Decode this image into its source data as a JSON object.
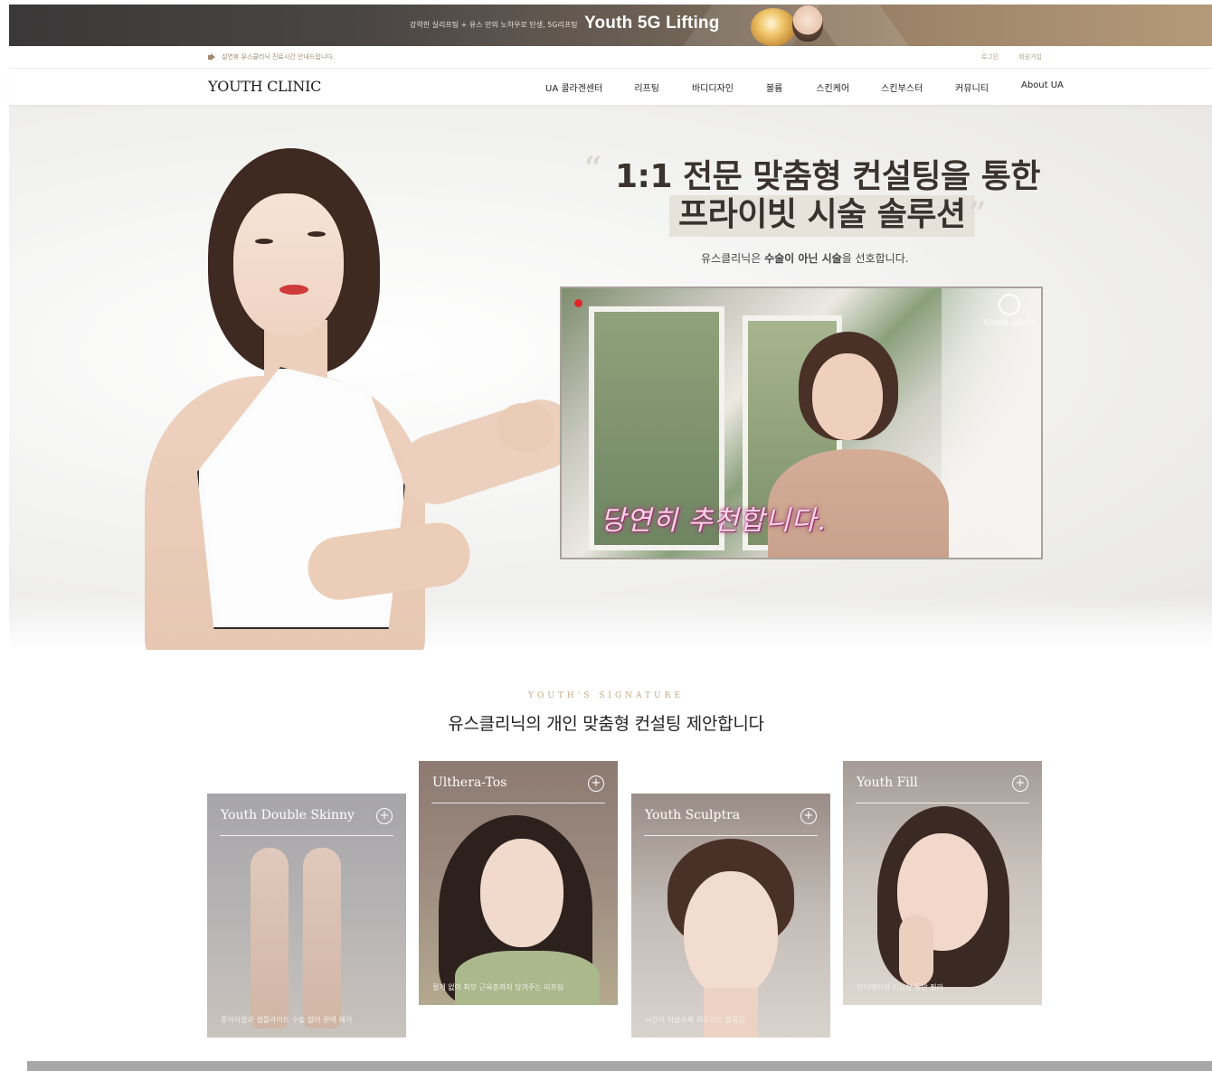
{
  "promo": {
    "small_text": "강력한 실리프팅 + 유스 만의 노하우로 탄생, 5G리프팅",
    "big_text": "Youth 5G Lifting"
  },
  "util": {
    "notice": "설연휴 유스클리닉 진료시간 안내드립니다.",
    "login": "로그인",
    "signup": "회원가입"
  },
  "nav": {
    "logo": "YOUTH CLINIC",
    "menu": [
      "UA 콜라겐센터",
      "리프팅",
      "바디디자인",
      "볼륨",
      "스킨케어",
      "스킨부스터",
      "커뮤니티",
      "About UA"
    ]
  },
  "hero": {
    "headline_line1": "1:1 전문 맞춤형 컨설팅을 통한",
    "headline_line2": "프라이빗 시술 솔루션",
    "sub_prefix": "유스클리닉은 ",
    "sub_bold": "수술이 아닌 시술",
    "sub_suffix": "을 선호합니다.",
    "video": {
      "logo_text": "Youth clinic",
      "caption": "당연히 추천합니다."
    }
  },
  "signature": {
    "eyebrow": "YOUTH'S SIGNATURE",
    "title": "유스클리닉의 개인 맞춤형 컨설팅 제안합니다",
    "cards": [
      {
        "title": "Youth Double Skinny",
        "desc": "종아리알과 셀룰라이트 수술 없이 완벽 제거"
      },
      {
        "title": "Ulthera-Tos",
        "desc": "절개 없이 피부 근육층까지 당겨주는 리프팅"
      },
      {
        "title": "Youth Sculptra",
        "desc": "시간이 지날수록 차오르는 볼륨감"
      },
      {
        "title": "Youth Fill",
        "desc": "안티에이징 기능성 동안 필러"
      }
    ]
  },
  "colors": {
    "accent_gold": "#c4a983",
    "headline": "#3a322c",
    "rec_red": "#e0262b"
  },
  "icons": [
    "speaker-icon",
    "plus-circle-icon",
    "youth-clinic-logo-icon",
    "record-dot-icon"
  ]
}
